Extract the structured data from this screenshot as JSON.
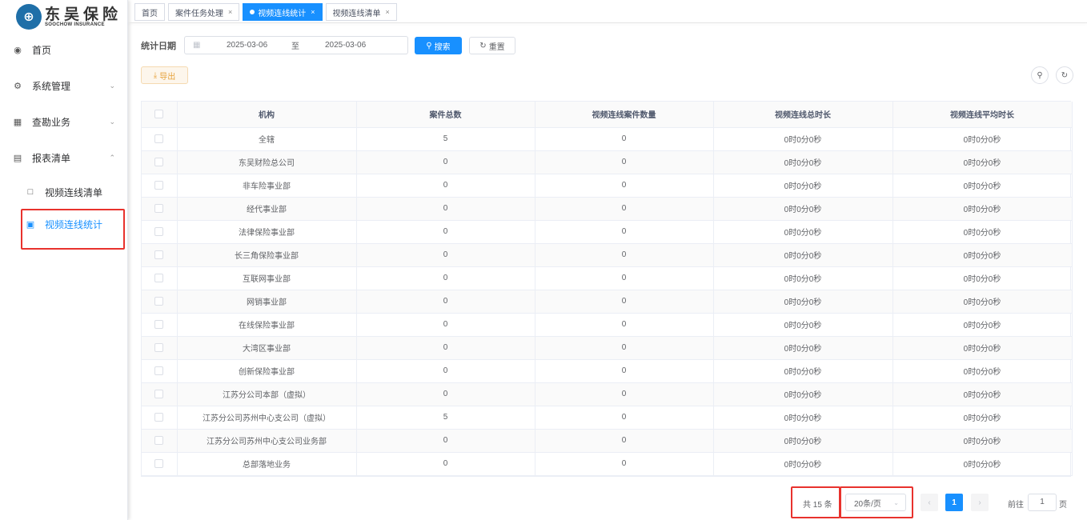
{
  "logo": {
    "cn": "东吴保险",
    "en": "SOOCHOW INSURANCE",
    "mark": "⊕"
  },
  "sidebar": {
    "items": [
      {
        "label": "首页",
        "icon": "dashboard-icon"
      },
      {
        "label": "系统管理",
        "icon": "gear-icon"
      },
      {
        "label": "查勘业务",
        "icon": "grid-icon"
      },
      {
        "label": "报表清单",
        "icon": "report-icon"
      },
      {
        "label": "视频连线清单",
        "icon": "chart-icon"
      },
      {
        "label": "视频连线统计",
        "icon": "stat-icon"
      }
    ]
  },
  "tabs": [
    {
      "label": "首页"
    },
    {
      "label": "案件任务处理"
    },
    {
      "label": "视频连线统计"
    },
    {
      "label": "视频连线清单"
    }
  ],
  "filter": {
    "label": "统计日期",
    "start": "2025-03-06",
    "separator": "至",
    "end": "2025-03-06",
    "search_label": "搜索",
    "reset_label": "重置",
    "export_label": "导出"
  },
  "table": {
    "headers": [
      "机构",
      "案件总数",
      "视频连线案件数量",
      "视频连线总时长",
      "视频连线平均时长"
    ],
    "rows": [
      [
        "全辖",
        "5",
        "0",
        "0时0分0秒",
        "0时0分0秒"
      ],
      [
        "东吴财险总公司",
        "0",
        "0",
        "0时0分0秒",
        "0时0分0秒"
      ],
      [
        "非车险事业部",
        "0",
        "0",
        "0时0分0秒",
        "0时0分0秒"
      ],
      [
        "经代事业部",
        "0",
        "0",
        "0时0分0秒",
        "0时0分0秒"
      ],
      [
        "法律保险事业部",
        "0",
        "0",
        "0时0分0秒",
        "0时0分0秒"
      ],
      [
        "长三角保险事业部",
        "0",
        "0",
        "0时0分0秒",
        "0时0分0秒"
      ],
      [
        "互联网事业部",
        "0",
        "0",
        "0时0分0秒",
        "0时0分0秒"
      ],
      [
        "网销事业部",
        "0",
        "0",
        "0时0分0秒",
        "0时0分0秒"
      ],
      [
        "在线保险事业部",
        "0",
        "0",
        "0时0分0秒",
        "0时0分0秒"
      ],
      [
        "大湾区事业部",
        "0",
        "0",
        "0时0分0秒",
        "0时0分0秒"
      ],
      [
        "创新保险事业部",
        "0",
        "0",
        "0时0分0秒",
        "0时0分0秒"
      ],
      [
        "江苏分公司本部（虚拟）",
        "0",
        "0",
        "0时0分0秒",
        "0时0分0秒"
      ],
      [
        "江苏分公司苏州中心支公司（虚拟）",
        "5",
        "0",
        "0时0分0秒",
        "0时0分0秒"
      ],
      [
        "江苏分公司苏州中心支公司业务部",
        "0",
        "0",
        "0时0分0秒",
        "0时0分0秒"
      ],
      [
        "总部落地业务",
        "0",
        "0",
        "0时0分0秒",
        "0时0分0秒"
      ]
    ]
  },
  "pagination": {
    "total_text": "共 15 条",
    "page_size": "20条/页",
    "current_page": "1",
    "goto_label": "前往",
    "goto_value": "1",
    "page_suffix": "页"
  },
  "colors": {
    "primary": "#1890ff",
    "highlight": "#e8322d",
    "warning": "#e6a23c"
  }
}
